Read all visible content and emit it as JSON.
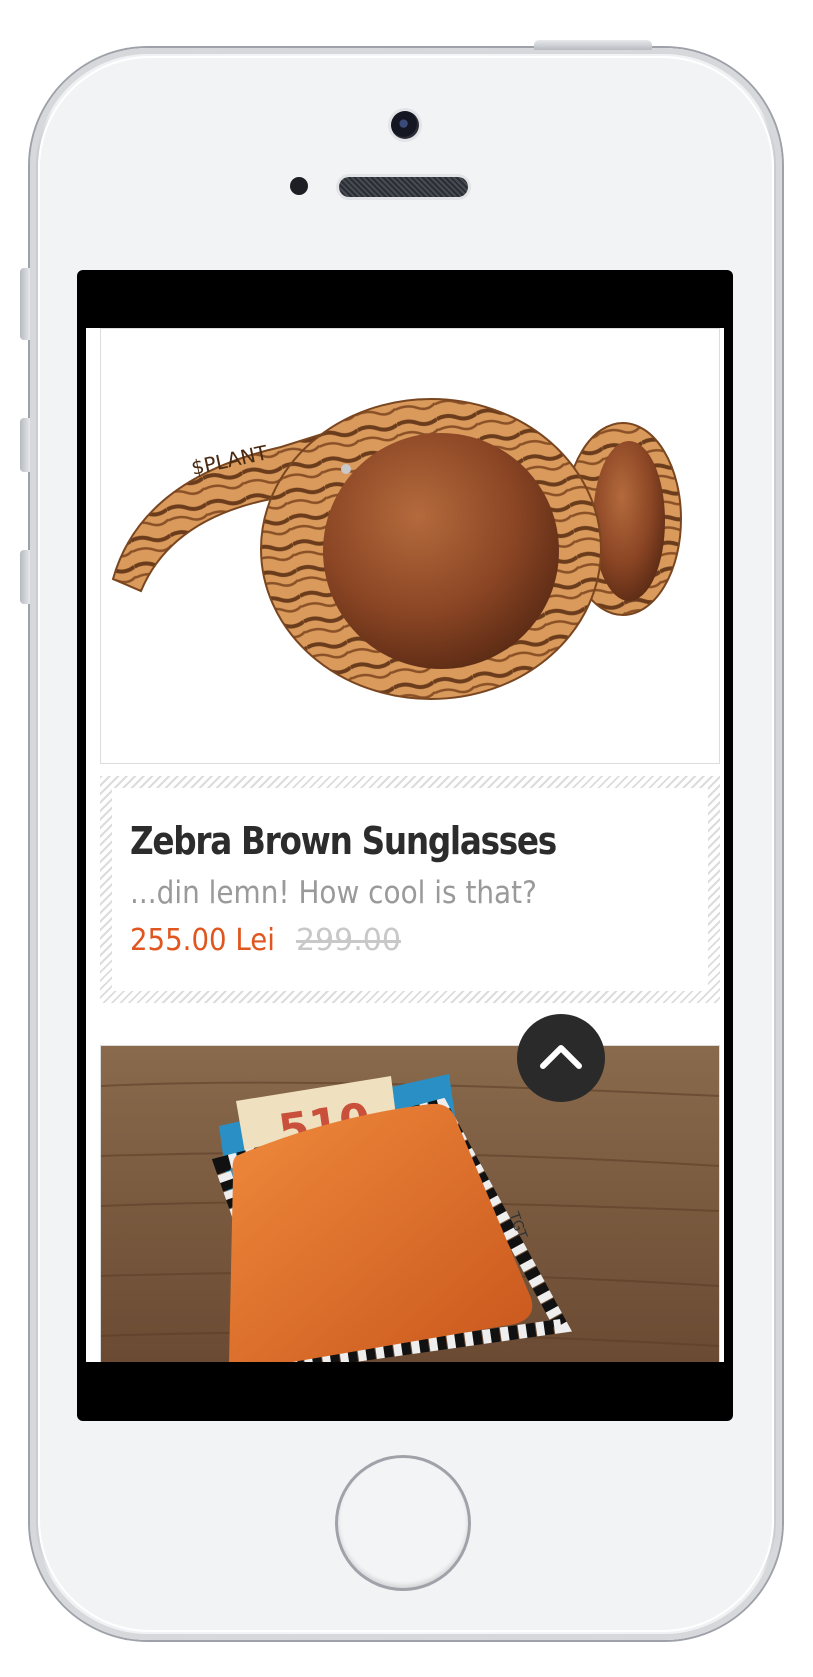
{
  "product": {
    "title": "Zebra Brown Sunglasses",
    "description": "...din lemn! How cool is that?",
    "price": "255.00 Lei",
    "old_price": "299.00",
    "price_color": "#e0561e",
    "brand_mark": "$PLANT"
  },
  "next_product": {
    "tag": "TGT",
    "banknote_text": "510"
  },
  "icons": {
    "scroll_top": "chevron-up-icon"
  }
}
